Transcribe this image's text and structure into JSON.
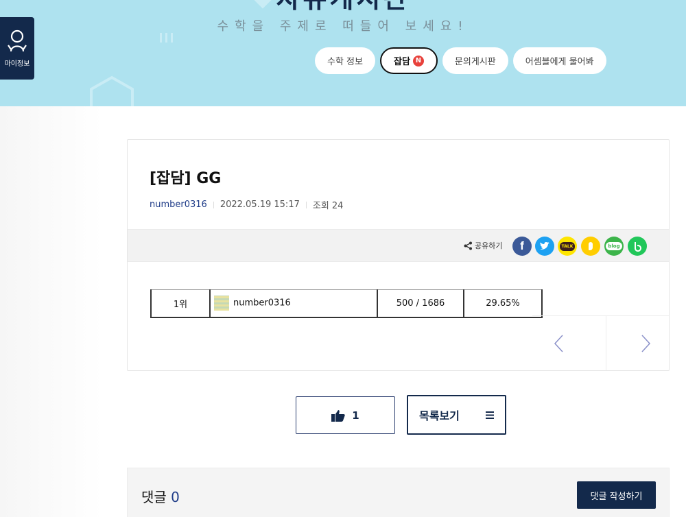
{
  "hero": {
    "title": "자유게시판",
    "subtitle": "수학을 주제로 떠들어 보세요!"
  },
  "myinfo": {
    "label": "마이정보",
    "icon": "user-icon"
  },
  "tabs": [
    {
      "label": "수학 정보",
      "active": false
    },
    {
      "label": "잡담",
      "active": true,
      "badge": "N"
    },
    {
      "label": "문의게시판",
      "active": false
    },
    {
      "label": "어셈블에게 물어봐",
      "active": false
    }
  ],
  "post": {
    "title": "[잡담] GG",
    "author": "number0316",
    "date": "2022.05.19 15:17",
    "views": "조회 24"
  },
  "share": {
    "label": "공유하기",
    "icons": [
      "facebook-icon",
      "twitter-icon",
      "kakaotalk-icon",
      "kakaostory-icon",
      "naver-blog-icon",
      "band-icon"
    ],
    "kakao_text": "TALK",
    "blog_text": "blog"
  },
  "ranking_image": {
    "rank": "1위",
    "name": "number0316",
    "score": "500 / 1686",
    "percent": "29.65%"
  },
  "actions": {
    "like_count": "1",
    "list_label": "목록보기"
  },
  "comments": {
    "title": "댓글",
    "count": "0",
    "write_label": "댓글 작성하기"
  },
  "colors": {
    "hero_bg": "#aee2ef",
    "navy": "#13294b",
    "badge_red": "#e8413b",
    "facebook": "#3b5998",
    "twitter": "#1da1f2",
    "kakao": "#fee500",
    "kakaostory": "#ffcd00",
    "naver_blog": "#3cb44a",
    "band": "#21c75a"
  }
}
